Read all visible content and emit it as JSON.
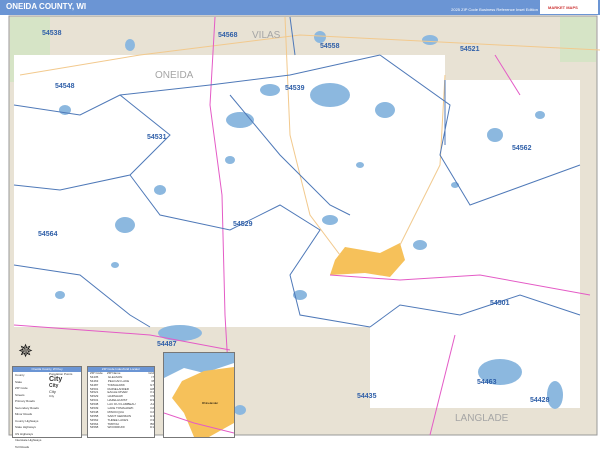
{
  "header": {
    "title": "ONEIDA COUNTY, WI",
    "edition": "2025 ZIP Code Business Reference Inset Edition",
    "logo": "MARKET MAPS"
  },
  "colors": {
    "header": "#6b95d4",
    "water": "#8cb8df",
    "outside": "#e8e2d4",
    "zip_boundary": "#4f79b8",
    "highway": "#e45bc6",
    "road": "#f2c98d",
    "city": "#f6c15a"
  },
  "neighbor_counties": [
    "ONEIDA",
    "VILAS",
    "LANGLADE"
  ],
  "zip_labels": [
    "54538",
    "54568",
    "54558",
    "54521",
    "54548",
    "54539",
    "54531",
    "54562",
    "54529",
    "54564",
    "54501",
    "54487",
    "54463",
    "54435",
    "54428"
  ],
  "legend": {
    "title": "Oneida County, WI Key",
    "items": [
      "County",
      "State",
      "ZIP Code",
      "Streets",
      "Primary Roads",
      "Secondary Roads",
      "Minor Roads",
      "County Highways",
      "State Highways",
      "US Highways",
      "Interstate Highways",
      "Toll Roads"
    ],
    "population_title": "Population Points",
    "city_labels": [
      "City",
      "City",
      "City",
      "City"
    ]
  },
  "index": {
    "title": "ZIP Code Index/Grid Locator",
    "headers": [
      "ZIP Code",
      "ZIP Name",
      "Grid"
    ],
    "rows": [
      [
        "54435",
        "GLEASON",
        "I7"
      ],
      [
        "54463",
        "PELICAN LAKE",
        "I8"
      ],
      [
        "54487",
        "TOMAHAWK",
        "G7"
      ],
      [
        "54501",
        "RHINELANDER",
        "H8"
      ],
      [
        "54521",
        "EAGLE RIVER",
        "K1"
      ],
      [
        "54529",
        "HARSHAW",
        "F5"
      ],
      [
        "54531",
        "HAZELHURST",
        "D3"
      ],
      [
        "54538",
        "LAC DU FLAMBEAU",
        "A1"
      ],
      [
        "54539",
        "LAKE TOMAHAWK",
        "F2"
      ],
      [
        "54548",
        "MINOCQUA",
        "C2"
      ],
      [
        "54558",
        "SAINT GERMAIN",
        "H1"
      ],
      [
        "54562",
        "THREE LAKES",
        "K3"
      ],
      [
        "54564",
        "TRIPOLI",
        "B6"
      ],
      [
        "54568",
        "WOODRUFF",
        "D1"
      ]
    ]
  },
  "inset": {
    "city": "Rhinelander"
  }
}
